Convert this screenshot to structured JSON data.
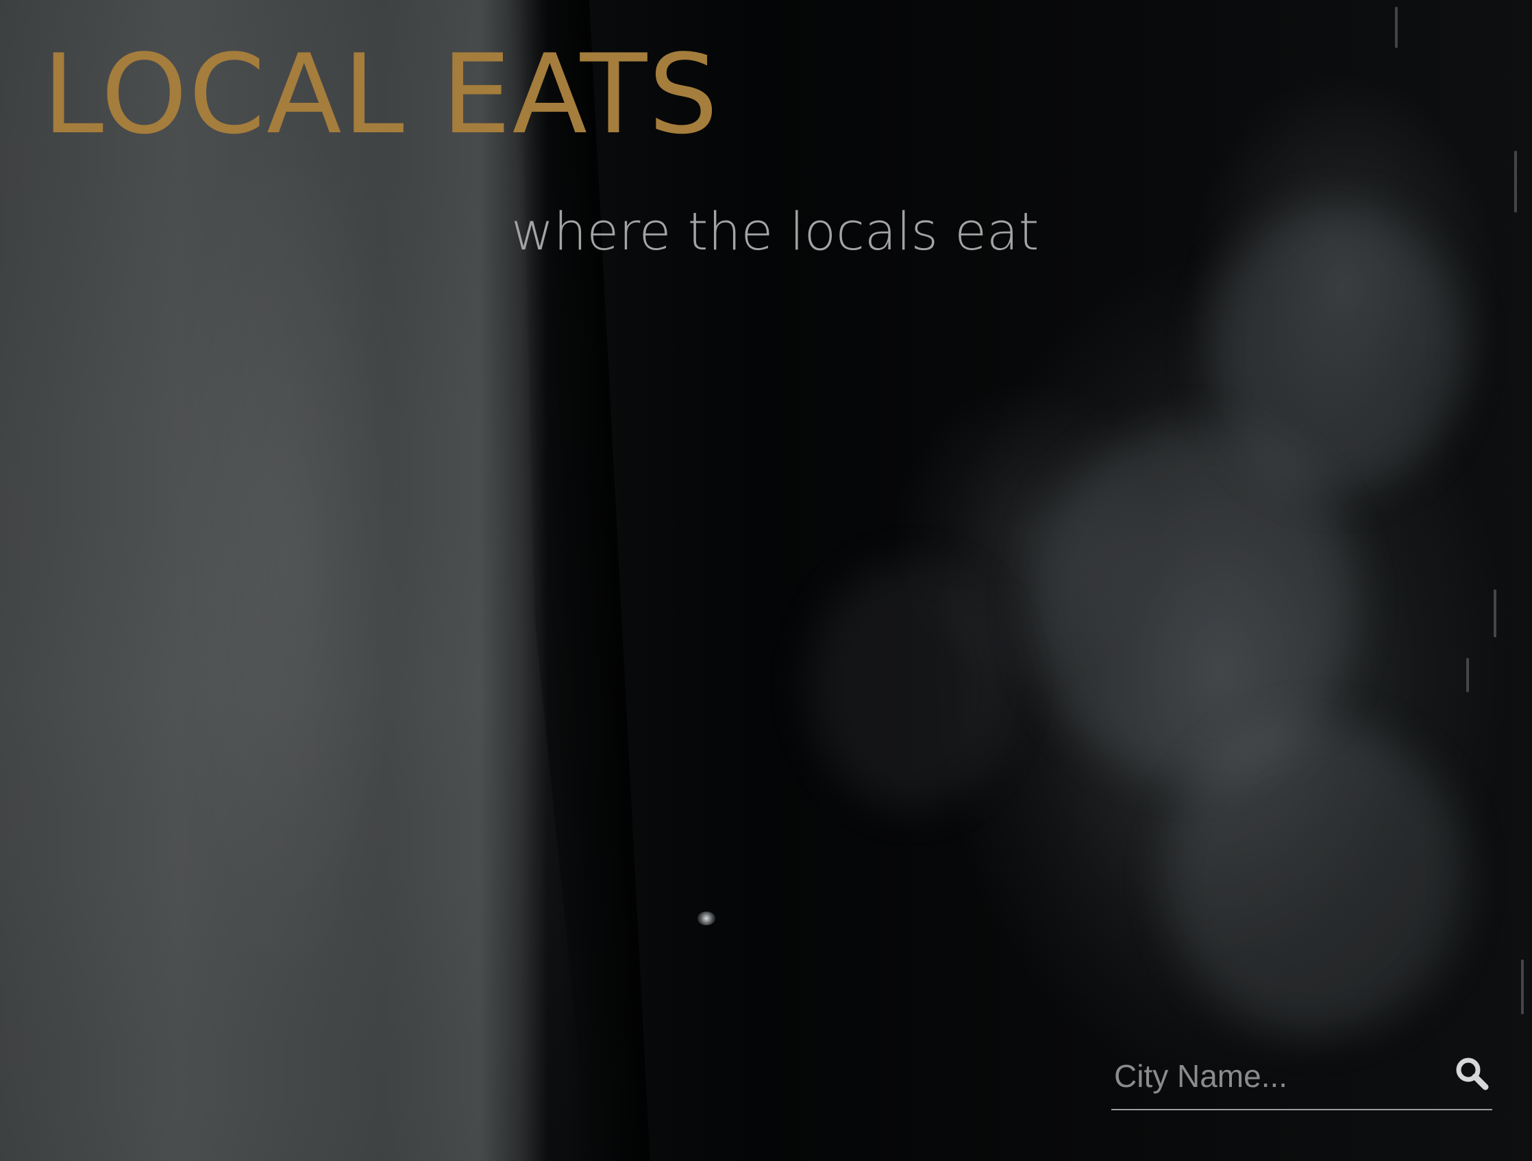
{
  "brand": {
    "title": "LOCAL EATS",
    "color": "#a57d3c"
  },
  "hero": {
    "tagline": "where the locals eat"
  },
  "search": {
    "placeholder": "City Name...",
    "value": "",
    "icon": "search-icon"
  }
}
